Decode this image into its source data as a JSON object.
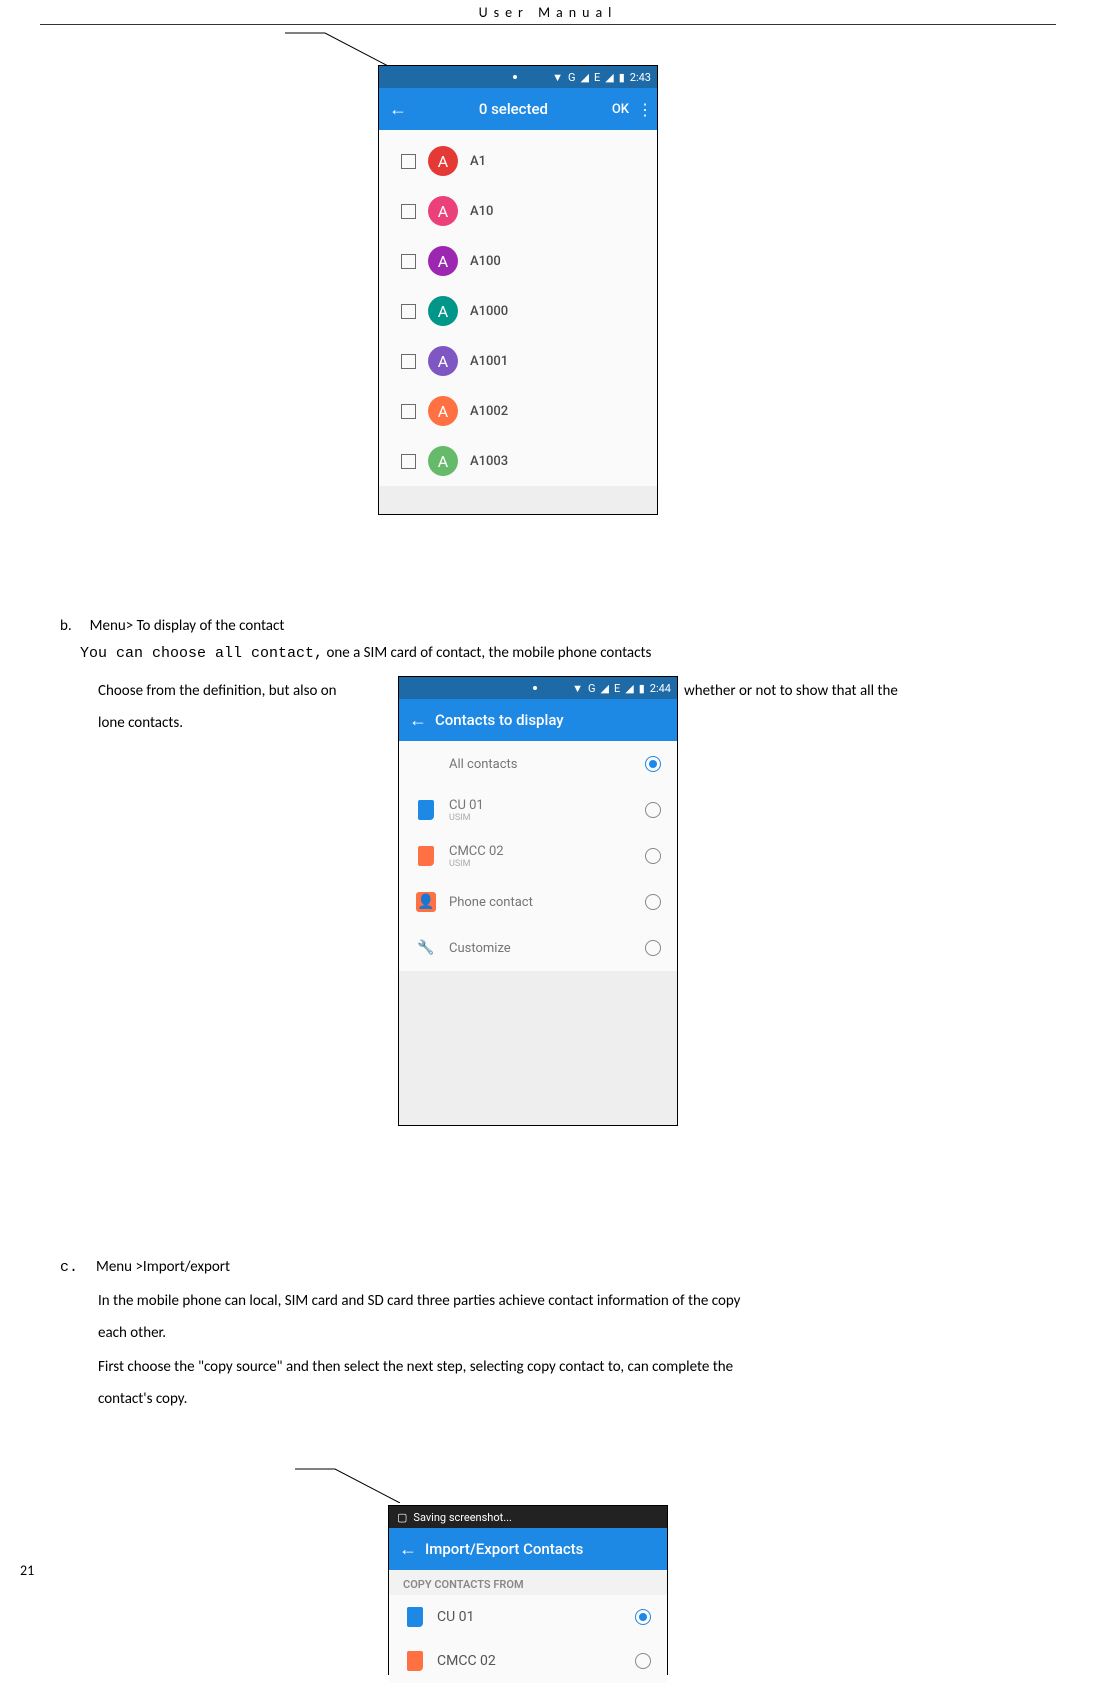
{
  "header": {
    "title": "User  Manual"
  },
  "page_number": "21",
  "screenshot1": {
    "statusbar": {
      "wifi_icon": "▼",
      "signal_letter_g": "G",
      "signal_letter_e": "E",
      "battery": "▮",
      "time": "2:43"
    },
    "appbar": {
      "back": "←",
      "title": "0 selected",
      "ok": "OK",
      "menu": "⋮"
    },
    "contacts": [
      {
        "initial": "A",
        "name": "A1",
        "color": "c0"
      },
      {
        "initial": "A",
        "name": "A10",
        "color": "c1"
      },
      {
        "initial": "A",
        "name": "A100",
        "color": "c2"
      },
      {
        "initial": "A",
        "name": "A1000",
        "color": "c3"
      },
      {
        "initial": "A",
        "name": "A1001",
        "color": "c4"
      },
      {
        "initial": "A",
        "name": "A1002",
        "color": "c5"
      },
      {
        "initial": "A",
        "name": "A1003",
        "color": "c6"
      }
    ]
  },
  "screenshot2": {
    "statusbar": {
      "time": "2:44"
    },
    "appbar": {
      "back": "←",
      "title": "Contacts to display"
    },
    "options": [
      {
        "label": "All contacts",
        "sub": "",
        "selected": true,
        "icon": ""
      },
      {
        "label": "CU 01",
        "sub": "USIM",
        "selected": false,
        "icon": "sim-b"
      },
      {
        "label": "CMCC 02",
        "sub": "USIM",
        "selected": false,
        "icon": "sim-o"
      },
      {
        "label": "Phone contact",
        "sub": "",
        "selected": false,
        "icon": "person"
      },
      {
        "label": "Customize",
        "sub": "",
        "selected": false,
        "icon": "wrench"
      }
    ]
  },
  "screenshot3": {
    "notif_text": "Saving screenshot...",
    "appbar": {
      "back": "←",
      "title": "Import/Export Contacts"
    },
    "section_title": "COPY CONTACTS FROM",
    "rows": [
      {
        "label": "CU 01",
        "icon": "sim-b",
        "selected": true
      },
      {
        "label": "CMCC 02",
        "icon": "sim-o",
        "selected": false
      }
    ]
  },
  "text": {
    "b_marker": "b.",
    "b_heading": "Menu> To display of the contact",
    "b_line2_mono": "You can choose all contact,",
    "b_line2_rest": " one a SIM card of contact, the mobile phone contacts",
    "b_line3_left": "Choose from the definition, but also on",
    "b_line3_right": "whether or not to show that all the",
    "b_line4": "lone contacts.",
    "c_marker": "c.",
    "c_heading": "Menu >Import/export",
    "c_p1": "In the mobile phone can local, SIM card and SD card three parties achieve contact information of the copy",
    "c_p2": "each other.",
    "c_p3": "First choose the \"copy source\" and then select the next step, selecting copy contact to, can complete the",
    "c_p4": "contact's copy."
  }
}
